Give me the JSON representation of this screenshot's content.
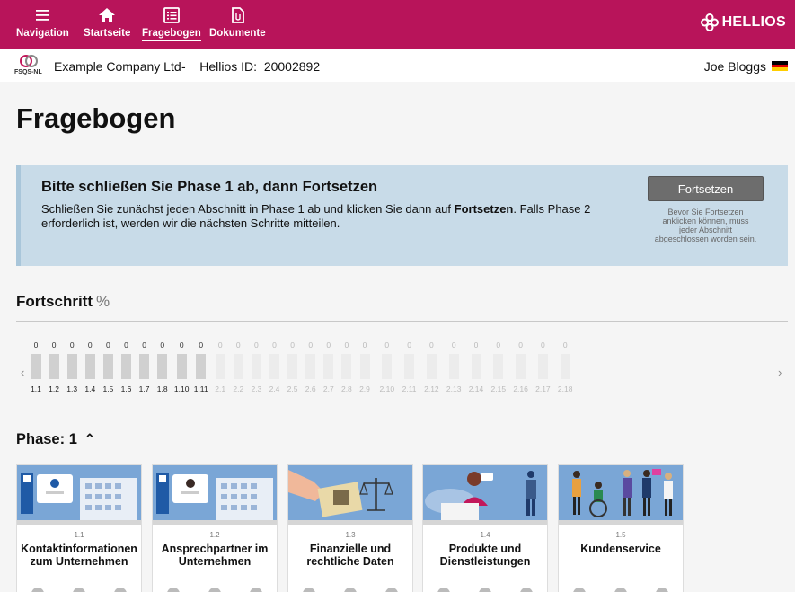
{
  "nav": {
    "items": [
      {
        "label": "Navigation",
        "icon": "menu-icon"
      },
      {
        "label": "Startseite",
        "icon": "home-icon"
      },
      {
        "label": "Fragebogen",
        "icon": "list-icon",
        "active": true
      },
      {
        "label": "Dokumente",
        "icon": "document-icon"
      }
    ],
    "brand": "HELLIOS",
    "color": "#b8145a"
  },
  "subheader": {
    "logo_text": "FSQS-NL",
    "company": "Example Company Ltd",
    "separator": "-",
    "hellios_id_label": "Hellios ID:",
    "hellios_id": "20002892",
    "user": "Joe Bloggs"
  },
  "page_title": "Fragebogen",
  "alert": {
    "title": "Bitte schließen Sie Phase 1 ab, dann Fortsetzen",
    "text_before": "Schließen Sie zunächst jeden Abschnitt in Phase 1 ab und klicken Sie dann auf ",
    "text_bold": "Fortsetzen",
    "text_after": ". Falls Phase 2 erforderlich ist, werden wir die nächsten Schritte mitteilen.",
    "button_label": "Fortsetzen",
    "button_note": "Bevor Sie Fortsetzen anklicken können, muss jeder Abschnitt abgeschlossen worden sein."
  },
  "progress": {
    "title": "Fortschritt",
    "unit": "%",
    "sections": [
      {
        "label": "1.1",
        "value": "0"
      },
      {
        "label": "1.2",
        "value": "0"
      },
      {
        "label": "1.3",
        "value": "0"
      },
      {
        "label": "1.4",
        "value": "0"
      },
      {
        "label": "1.5",
        "value": "0"
      },
      {
        "label": "1.6",
        "value": "0"
      },
      {
        "label": "1.7",
        "value": "0"
      },
      {
        "label": "1.8",
        "value": "0"
      },
      {
        "label": "1.10",
        "value": "0"
      },
      {
        "label": "1.11",
        "value": "0"
      },
      {
        "label": "2.1",
        "value": "0"
      },
      {
        "label": "2.2",
        "value": "0"
      },
      {
        "label": "2.3",
        "value": "0"
      },
      {
        "label": "2.4",
        "value": "0"
      },
      {
        "label": "2.5",
        "value": "0"
      },
      {
        "label": "2.6",
        "value": "0"
      },
      {
        "label": "2.7",
        "value": "0"
      },
      {
        "label": "2.8",
        "value": "0"
      },
      {
        "label": "2.9",
        "value": "0"
      },
      {
        "label": "2.10",
        "value": "0"
      },
      {
        "label": "2.11",
        "value": "0"
      },
      {
        "label": "2.12",
        "value": "0"
      },
      {
        "label": "2.13",
        "value": "0"
      },
      {
        "label": "2.14",
        "value": "0"
      },
      {
        "label": "2.15",
        "value": "0"
      },
      {
        "label": "2.16",
        "value": "0"
      },
      {
        "label": "2.17",
        "value": "0"
      },
      {
        "label": "2.18",
        "value": "0"
      }
    ]
  },
  "phase": {
    "title": "Phase: 1",
    "cards": [
      {
        "number": "1.1",
        "name": "Kontaktinformationen zum Unternehmen"
      },
      {
        "number": "1.2",
        "name": "Ansprechpartner im Unternehmen"
      },
      {
        "number": "1.3",
        "name": "Finanzielle und rechtliche Daten"
      },
      {
        "number": "1.4",
        "name": "Produkte und Dienstleistungen"
      },
      {
        "number": "1.5",
        "name": "Kundenservice"
      }
    ]
  }
}
